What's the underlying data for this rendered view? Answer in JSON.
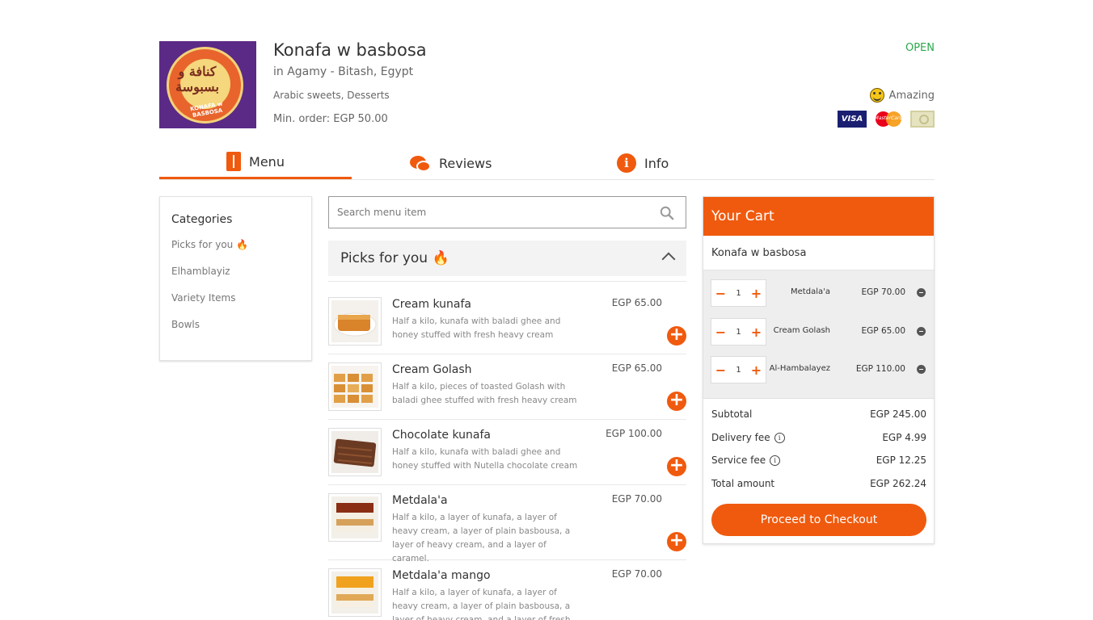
{
  "restaurant": {
    "name": "Konafa w basbosa",
    "location": "in Agamy - Bitash, Egypt",
    "cuisine": "Arabic sweets, Desserts",
    "min_order": "Min. order: EGP 50.00",
    "status": "OPEN",
    "rating": "Amazing",
    "logo_text_arabic": "كنافة و بسبوسة",
    "logo_text_latin": "KONAFA w BASBOSA",
    "payments": [
      "VISA",
      "MasterCard"
    ]
  },
  "tabs": [
    {
      "label": "Menu",
      "icon": "menu-icon",
      "active": true
    },
    {
      "label": "Reviews",
      "icon": "chat-bubble-icon",
      "active": false
    },
    {
      "label": "Info",
      "icon": "info-icon",
      "active": false
    }
  ],
  "categories": {
    "title": "Categories",
    "items": [
      "Picks for you 🔥",
      "Elhamblayiz",
      "Variety Items",
      "Bowls"
    ]
  },
  "search": {
    "placeholder": "Search menu item"
  },
  "section": {
    "title": "Picks for you 🔥"
  },
  "menu_items": [
    {
      "name": "Cream kunafa",
      "price": "EGP 65.00",
      "desc": "Half a kilo, kunafa with baladi ghee and honey stuffed with fresh heavy cream"
    },
    {
      "name": "Cream Golash",
      "price": "EGP 65.00",
      "desc": "Half a kilo, pieces of toasted Golash with baladi ghee stuffed with fresh heavy cream"
    },
    {
      "name": "Chocolate kunafa",
      "price": "EGP 100.00",
      "desc": "Half a kilo, kunafa with baladi ghee and honey stuffed with Nutella chocolate cream"
    },
    {
      "name": "Metdala'a",
      "price": "EGP 70.00",
      "desc": "Half a kilo, a layer of kunafa, a layer of heavy cream, a layer of plain basbousa, a layer of heavy cream, and a layer of caramel."
    },
    {
      "name": "Metdala'a mango",
      "price": "EGP 70.00",
      "desc": "Half a kilo, a layer of kunafa, a layer of heavy cream, a layer of plain basbousa, a layer of heavy cream, and a layer of fresh mango"
    }
  ],
  "cart": {
    "title": "Your Cart",
    "restaurant": "Konafa w basbosa",
    "items": [
      {
        "qty": "1",
        "name": "Metdala'a",
        "price": "EGP 70.00"
      },
      {
        "qty": "1",
        "name": "Cream Golash",
        "price": "EGP 65.00"
      },
      {
        "qty": "1",
        "name": "Al-Hambalayez",
        "price": "EGP 110.00"
      }
    ],
    "subtotal_label": "Subtotal",
    "subtotal": "EGP 245.00",
    "delivery_label": "Delivery fee",
    "delivery": "EGP 4.99",
    "service_label": "Service fee",
    "service": "EGP 12.25",
    "total_label": "Total amount",
    "total": "EGP 262.24",
    "checkout_label": "Proceed to Checkout"
  },
  "colors": {
    "accent": "#f05a0e",
    "open": "#2aa84a"
  }
}
